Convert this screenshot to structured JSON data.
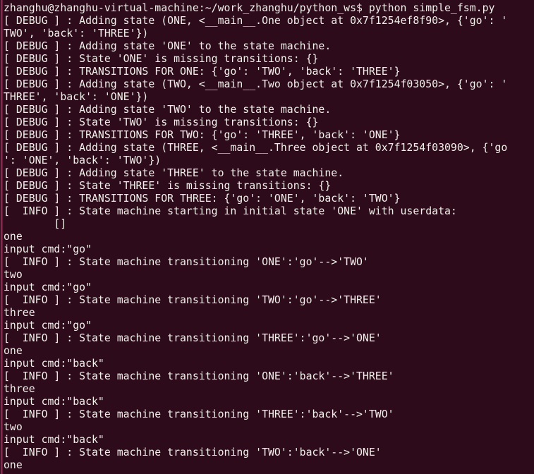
{
  "terminal": {
    "title": "zhanghu@zhanghu-virtual-machine: ~/work_zhanghu/python_ws",
    "colors": {
      "background": "#2d0b1a",
      "foreground": "#f2f0eb",
      "scrollbar": "#8c3055"
    },
    "prompt": {
      "user": "zhanghu",
      "host": "zhanghu-virtual-machine",
      "cwd": "~/work_zhanghu/python_ws",
      "symbol": "$",
      "command": "python simple_fsm.py"
    },
    "lines": [
      "zhanghu@zhanghu-virtual-machine:~/work_zhanghu/python_ws$ python simple_fsm.py",
      "[ DEBUG ] : Adding state (ONE, <__main__.One object at 0x7f1254ef8f90>, {'go': '",
      "TWO', 'back': 'THREE'})",
      "[ DEBUG ] : Adding state 'ONE' to the state machine.",
      "[ DEBUG ] : State 'ONE' is missing transitions: {}",
      "[ DEBUG ] : TRANSITIONS FOR ONE: {'go': 'TWO', 'back': 'THREE'}",
      "[ DEBUG ] : Adding state (TWO, <__main__.Two object at 0x7f1254f03050>, {'go': '",
      "THREE', 'back': 'ONE'})",
      "[ DEBUG ] : Adding state 'TWO' to the state machine.",
      "[ DEBUG ] : State 'TWO' is missing transitions: {}",
      "[ DEBUG ] : TRANSITIONS FOR TWO: {'go': 'THREE', 'back': 'ONE'}",
      "[ DEBUG ] : Adding state (THREE, <__main__.Three object at 0x7f1254f03090>, {'go",
      "': 'ONE', 'back': 'TWO'})",
      "[ DEBUG ] : Adding state 'THREE' to the state machine.",
      "[ DEBUG ] : State 'THREE' is missing transitions: {}",
      "[ DEBUG ] : TRANSITIONS FOR THREE: {'go': 'ONE', 'back': 'TWO'}",
      "[  INFO ] : State machine starting in initial state 'ONE' with userdata:",
      "        []",
      "one",
      "input cmd:\"go\"",
      "[  INFO ] : State machine transitioning 'ONE':'go'-->'TWO'",
      "two",
      "input cmd:\"go\"",
      "[  INFO ] : State machine transitioning 'TWO':'go'-->'THREE'",
      "three",
      "input cmd:\"go\"",
      "[  INFO ] : State machine transitioning 'THREE':'go'-->'ONE'",
      "one",
      "input cmd:\"back\"",
      "[  INFO ] : State machine transitioning 'ONE':'back'-->'THREE'",
      "three",
      "input cmd:\"back\"",
      "[  INFO ] : State machine transitioning 'THREE':'back'-->'TWO'",
      "two",
      "input cmd:\"back\"",
      "[  INFO ] : State machine transitioning 'TWO':'back'-->'ONE'",
      "one"
    ]
  }
}
